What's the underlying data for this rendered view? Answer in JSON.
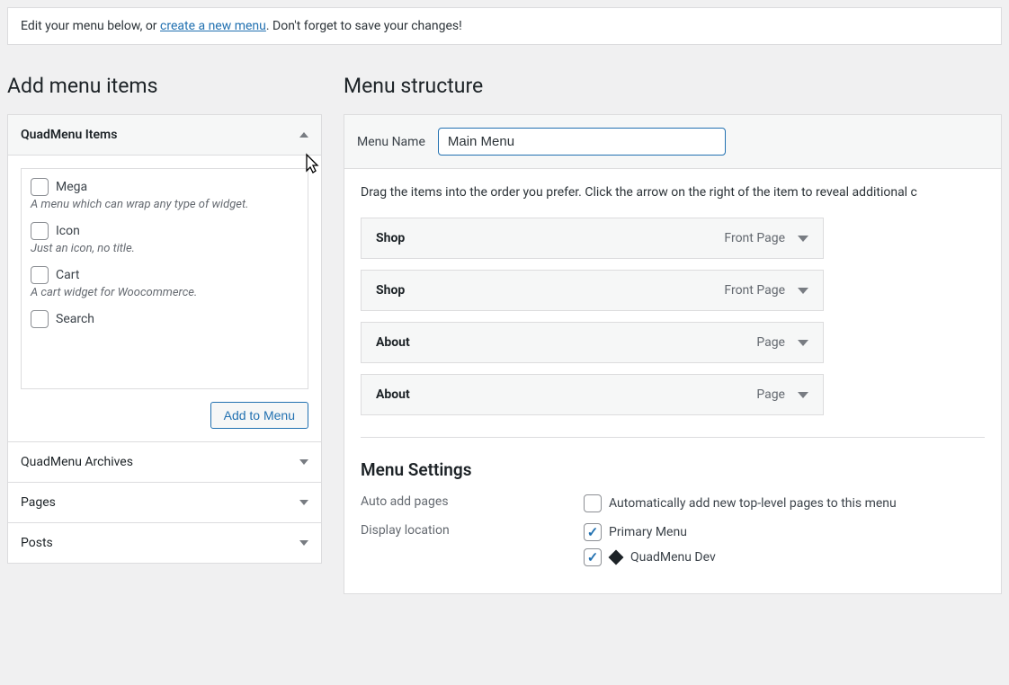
{
  "notice": {
    "prefix": "Edit your menu below, or ",
    "link": "create a new menu",
    "suffix": ". Don't forget to save your changes!"
  },
  "left": {
    "heading": "Add menu items",
    "panel_title": "QuadMenu Items",
    "items": [
      {
        "label": "Mega",
        "desc": "A menu which can wrap any type of widget."
      },
      {
        "label": "Icon",
        "desc": "Just an icon, no title."
      },
      {
        "label": "Cart",
        "desc": "A cart widget for Woocommerce."
      },
      {
        "label": "Search",
        "desc": ""
      }
    ],
    "add_button": "Add to Menu",
    "other_panels": [
      "QuadMenu Archives",
      "Pages",
      "Posts"
    ]
  },
  "right": {
    "heading": "Menu structure",
    "menu_name_label": "Menu Name",
    "menu_name_value": "Main Menu",
    "instructions": "Drag the items into the order you prefer. Click the arrow on the right of the item to reveal additional c",
    "menu_items": [
      {
        "title": "Shop",
        "type": "Front Page"
      },
      {
        "title": "Shop",
        "type": "Front Page"
      },
      {
        "title": "About",
        "type": "Page"
      },
      {
        "title": "About",
        "type": "Page"
      }
    ],
    "settings_title": "Menu Settings",
    "auto_add_label": "Auto add pages",
    "auto_add_option": "Automatically add new top-level pages to this menu",
    "display_loc_label": "Display location",
    "display_options": [
      {
        "label": "Primary Menu",
        "checked": true,
        "diamond": false
      },
      {
        "label": "QuadMenu Dev",
        "checked": true,
        "diamond": true
      }
    ]
  }
}
